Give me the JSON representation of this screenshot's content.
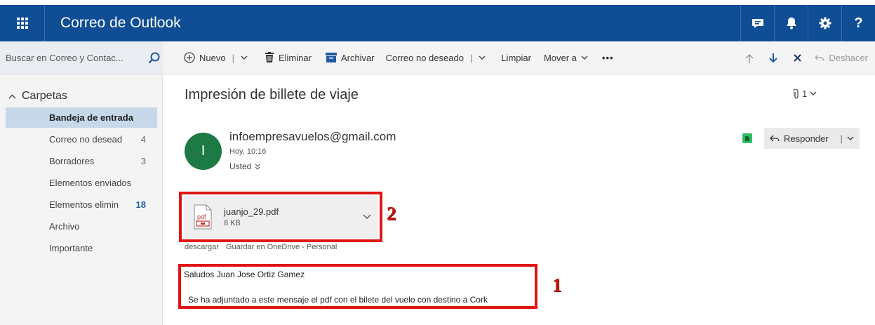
{
  "app": {
    "title": "Correo de Outlook"
  },
  "header_icons": [
    "chat-icon",
    "bell-icon",
    "gear-icon",
    "help-icon"
  ],
  "header_help": "?",
  "search": {
    "placeholder": "Buscar en Correo y Contac..."
  },
  "toolbar": {
    "new_label": "Nuevo",
    "delete_label": "Eliminar",
    "archive_label": "Archivar",
    "junk_label": "Correo no deseado",
    "sweep_label": "Limpiar",
    "move_label": "Mover a",
    "more_label": "•••",
    "undo_label": "Deshacer"
  },
  "sidebar": {
    "header": "Carpetas",
    "folders": [
      {
        "name": "Bandeja de entrada",
        "count": ""
      },
      {
        "name": "Correo no desead",
        "count": "4"
      },
      {
        "name": "Borradores",
        "count": "3"
      },
      {
        "name": "Elementos enviados",
        "count": ""
      },
      {
        "name": "Elementos elimin",
        "count": "18"
      },
      {
        "name": "Archivo",
        "count": ""
      },
      {
        "name": "Importante",
        "count": ""
      }
    ]
  },
  "message": {
    "subject": "Impresión de billete de viaje",
    "attachment_count": "1",
    "avatar_initial": "I",
    "sender": "infoempresavuelos@gmail.com",
    "time": "Hoy, 10:16",
    "recipient": "Usted",
    "reply_label": "Responder",
    "attachment": {
      "name": "juanjo_29.pdf",
      "size": "8 KB",
      "download_label": "descargar",
      "onedrive_label": "Guardar en OneDrive - Personal"
    },
    "body_greeting": "Saludos Juan Jose Ortiz Gamez",
    "body_text": "Se ha adjuntado a este mensaje el pdf con el bilete del vuelo con destino a Cork"
  },
  "annotations": {
    "label_1": "1",
    "label_2": "2"
  },
  "colors": {
    "header_bg": "#0f4d95",
    "selected_folder": "#c7d8ea",
    "annotation_red": "#e01515",
    "avatar": "#1d7a45"
  }
}
